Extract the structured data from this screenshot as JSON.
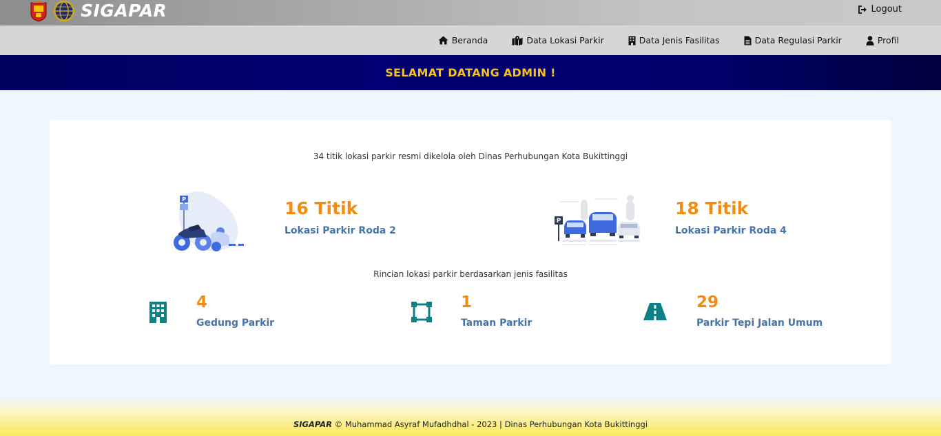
{
  "header": {
    "brand": "SIGAPAR",
    "logout_label": "Logout",
    "logos": [
      "city-crest-logo",
      "dishub-globe-logo"
    ]
  },
  "nav": {
    "items": [
      {
        "label": "Beranda",
        "icon": "home-icon"
      },
      {
        "label": "Data Lokasi Parkir",
        "icon": "map-marker-icon"
      },
      {
        "label": "Data Jenis Fasilitas",
        "icon": "building-icon"
      },
      {
        "label": "Data Regulasi Parkir",
        "icon": "document-icon"
      },
      {
        "label": "Profil",
        "icon": "user-icon"
      }
    ]
  },
  "welcome": {
    "text": "SELAMAT DATANG ADMIN !"
  },
  "summary": {
    "intro": "34 titik lokasi parkir resmi dikelola oleh Dinas Perhubungan Kota Bukittinggi",
    "roda2": {
      "count": "16 Titik",
      "label": "Lokasi Parkir Roda 2"
    },
    "roda4": {
      "count": "18 Titik",
      "label": "Lokasi Parkir Roda 4"
    },
    "facility_intro": "Rincian lokasi parkir berdasarkan jenis fasilitas",
    "facilities": [
      {
        "count": "4",
        "label": "Gedung Parkir",
        "icon": "building-icon"
      },
      {
        "count": "1",
        "label": "Taman Parkir",
        "icon": "vector-square-icon"
      },
      {
        "count": "29",
        "label": "Parkir Tepi Jalan Umum",
        "icon": "road-icon"
      }
    ]
  },
  "footer": {
    "brand": "SIGAPAR",
    "text": "© Muhammad Asyraf Mufadhdhal - 2023 | Dinas Perhubungan Kota Bukittinggi"
  },
  "colors": {
    "accent_orange": "#f28c13",
    "label_blue": "#4674a9",
    "welcome_yellow": "#f8c31a",
    "navy": "#000072",
    "teal_icon": "#0f7f86"
  }
}
